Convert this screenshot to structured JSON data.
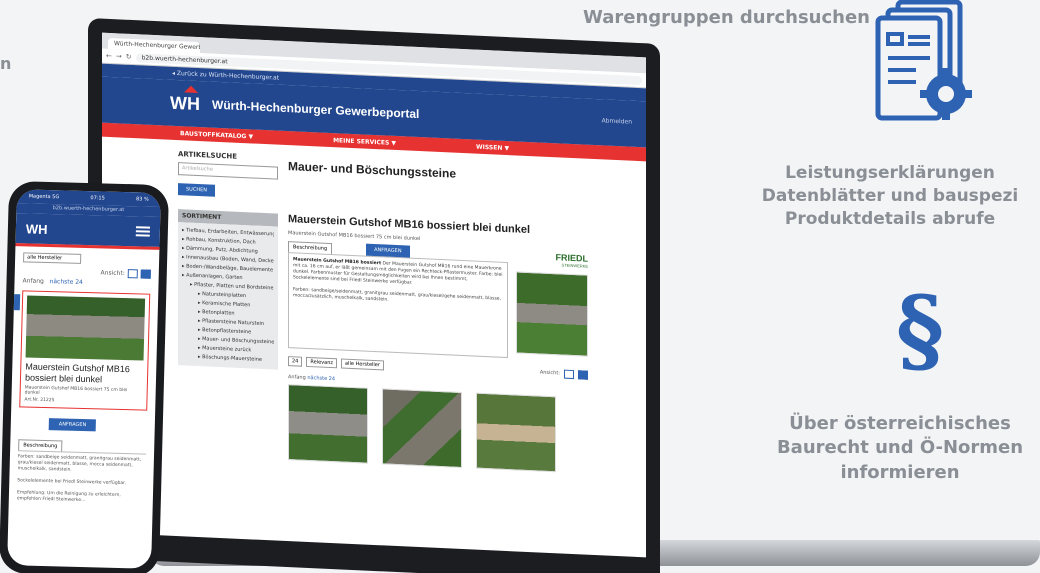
{
  "marketing": {
    "left_fragment": "n",
    "feature1": "Warengruppen durchsuchen",
    "feature2_lines": [
      "Leistungserklärungen",
      "Datenblätter und bauspezi",
      "Produktdetails abrufe"
    ],
    "feature3_lines": [
      "Über österreichisches",
      "Baurecht und Ö-Normen",
      "informieren"
    ],
    "paragraph_symbol": "§",
    "accent_color": "#2d63b2"
  },
  "laptop": {
    "tab_title": "Würth-Hechenburger Gewerb...",
    "url": "b2b.wuerth-hechenburger.at",
    "back_link": "◂ Zurück zu Würth-Hechenburger.at",
    "logo": "WH",
    "site_title": "Würth-Hechenburger Gewerbeportal",
    "header_right": "Abmelden",
    "menu": [
      "BAUSTOFFKATALOG ▼",
      "MEINE SERVICES ▼",
      "WISSEN ▼"
    ],
    "search_label": "ARTIKELSUCHE",
    "search_placeholder": "Artikelsuche",
    "search_button": "SUCHEN",
    "sort_heading": "SORTIMENT",
    "sort_items": [
      {
        "label": "Tiefbau, Erdarbeiten, Entwässerung",
        "level": 0
      },
      {
        "label": "Rohbau, Konstruktion, Dach",
        "level": 0
      },
      {
        "label": "Dämmung, Putz, Abdichtung",
        "level": 0
      },
      {
        "label": "Innenausbau (Boden, Wand, Decke)",
        "level": 0
      },
      {
        "label": "Boden-/Wandbeläge, Bauelemente",
        "level": 0
      },
      {
        "label": "Außenanlagen, Garten",
        "level": 0
      },
      {
        "label": "Pflaster, Platten und Bordsteine",
        "level": 1
      },
      {
        "label": "Natursteinplatten",
        "level": 2
      },
      {
        "label": "Keramische Platten",
        "level": 2
      },
      {
        "label": "Betonplatten",
        "level": 2
      },
      {
        "label": "Pflastersteine Naturstein",
        "level": 2
      },
      {
        "label": "Betonpflastersteine",
        "level": 2
      },
      {
        "label": "Mauer- und Böschungssteine",
        "level": 2
      },
      {
        "label": "Mauersteine zurück",
        "level": 2
      },
      {
        "label": "Böschungs-Mauersteine",
        "level": 2
      }
    ],
    "page_heading": "Mauer- und Böschungssteine",
    "product_title": "Mauerstein Gutshof MB16 bossiert blei dunkel",
    "product_sub": "Mauerstein Gutshof MB16 bossiert 75 cm blei dunkel",
    "desc_tab": "Beschreibung",
    "request_button": "ANFRAGEN",
    "brand": "FRIEDL",
    "brand_sub": "STEINWERKE",
    "desc_bold": "Mauerstein Gutshof MB16 bossiert",
    "desc_text": "Der Mauerstein Gutshof MB16 rund eine Mauerkrone mit ca. 16 cm auf, er läßt gemeinsam mit den Fugen ein Rechteck-Pflastermuster. Farbe: blei dunkel. Farbenmuster für Gestaltungsmöglichkeiten wird bei Ihnen bestimmt, Sockelelemente sind bei Friedl Steinwerke verfügbar.",
    "desc_text2": "Farben: sandbeige/seidenmatt, granitgrau seidenmatt, grau/kiesel/gehe seidenmatt, blasse, mocca/zusätzlich, muschelkalk, sandstein.",
    "per_page": "24",
    "sort_select": "Relevanz",
    "filter_select": "alle Hersteller",
    "view_label": "Ansicht:",
    "pager_prefix": "Anfang",
    "pager_next": "nächste 24"
  },
  "phone": {
    "status_left": "Magenta 5G",
    "status_time": "07:15",
    "status_right": "83 %",
    "url": "b2b.wuerth-hechenburger.at",
    "logo": "WH",
    "select": "alle Hersteller",
    "view_label": "Ansicht:",
    "pager_prefix": "Anfang",
    "pager_next": "nächste 24",
    "product_title": "Mauerstein Gutshof MB16 bossiert blei dunkel",
    "product_sub": "Mauerstein Gutshof MB16 bossiert 75 cm blei dunkel",
    "code": "Art.Nr. 21225",
    "button": "ANFRAGEN",
    "desc_tab": "Beschreibung",
    "desc1": "Farben: sandbeige seidenmatt, granitgrau seidenmatt, grau/kiesel seidenmatt, blasse, mocca seidenmatt, muschelkalk, sandstein.",
    "desc2": "Sockelelemente bei Friedl Steinwerke verfügbar.",
    "desc3": "Empfehlung: Um die Reinigung zu erleichtern, empfehlen Friedl Steinwerke..."
  }
}
